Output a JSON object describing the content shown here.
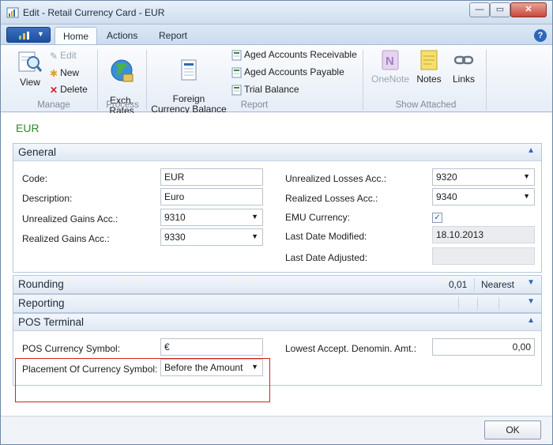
{
  "window": {
    "title": "Edit - Retail Currency Card - EUR"
  },
  "ribbon": {
    "tabs": [
      {
        "label": "Home"
      },
      {
        "label": "Actions"
      },
      {
        "label": "Report"
      }
    ],
    "manage": {
      "label": "Manage",
      "view": "View",
      "edit": "Edit",
      "new": "New",
      "delete": "Delete"
    },
    "process": {
      "label": "Process",
      "exch_rates": "Exch.\nRates"
    },
    "report": {
      "label": "Report",
      "foreign_currency_balance": "Foreign\nCurrency Balance",
      "aged_accounts_receivable": "Aged Accounts Receivable",
      "aged_accounts_payable": "Aged Accounts Payable",
      "trial_balance": "Trial Balance"
    },
    "show_attached": {
      "label": "Show Attached",
      "onenote": "OneNote",
      "notes": "Notes",
      "links": "Links"
    }
  },
  "card": {
    "title": "EUR"
  },
  "general": {
    "title": "General",
    "code_label": "Code:",
    "code_value": "EUR",
    "description_label": "Description:",
    "description_value": "Euro",
    "unrealized_gains_label": "Unrealized Gains Acc.:",
    "unrealized_gains_value": "9310",
    "realized_gains_label": "Realized Gains Acc.:",
    "realized_gains_value": "9330",
    "unrealized_losses_label": "Unrealized Losses Acc.:",
    "unrealized_losses_value": "9320",
    "realized_losses_label": "Realized Losses Acc.:",
    "realized_losses_value": "9340",
    "emu_currency_label": "EMU Currency:",
    "emu_currency_checked": true,
    "last_date_modified_label": "Last Date Modified:",
    "last_date_modified_value": "18.10.2013",
    "last_date_adjusted_label": "Last Date Adjusted:",
    "last_date_adjusted_value": ""
  },
  "rounding": {
    "title": "Rounding",
    "precision": "0,01",
    "type": "Nearest"
  },
  "reporting": {
    "title": "Reporting"
  },
  "pos_terminal": {
    "title": "POS Terminal",
    "currency_symbol_label": "POS Currency Symbol:",
    "currency_symbol_value": "€",
    "placement_label": "Placement Of Currency Symbol:",
    "placement_value": "Before the Amount",
    "lowest_denomin_label": "Lowest Accept. Denomin. Amt.:",
    "lowest_denomin_value": "0,00"
  },
  "footer": {
    "ok_label": "OK"
  },
  "colors": {
    "accent": "#2d68b8",
    "card_title": "#2e8b2e",
    "highlight": "#d42020"
  }
}
